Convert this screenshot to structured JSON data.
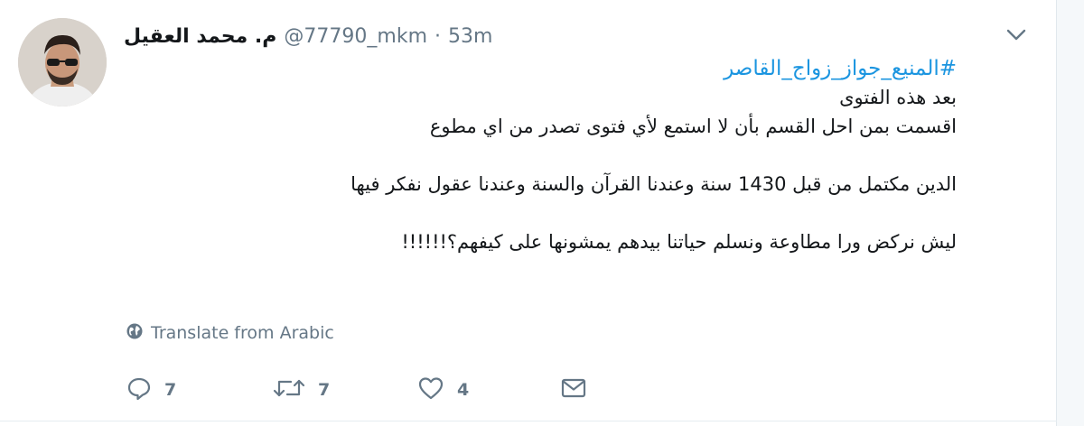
{
  "tweet": {
    "author_name": "م. محمد العقيل",
    "handle": "@77790_mkm",
    "separator": "·",
    "time": "53m",
    "hashtag": "#المنيع_جواز_زواج_القاصر",
    "lines": [
      "بعد هذه الفتوى",
      "اقسمت بمن احل القسم بأن لا استمع لأي فتوى تصدر من اي مطوع",
      "",
      "الدين مكتمل من قبل 1430 سنة وعندنا القرآن والسنة وعندنا عقول نفكر فيها",
      "",
      "ليش نركض ورا مطاوعة ونسلم حياتنا بيدهم يمشونها على كيفهم؟!!!!!!"
    ],
    "translate_label": "Translate from Arabic"
  },
  "actions": {
    "reply_count": "7",
    "retweet_count": "7",
    "like_count": "4"
  },
  "icons": {
    "caret": "chevron-down-icon",
    "globe": "globe-icon",
    "reply": "reply-icon",
    "retweet": "retweet-icon",
    "like": "heart-icon",
    "message": "envelope-icon"
  },
  "colors": {
    "link": "#1b95e0",
    "text": "#14171a",
    "muted": "#657786"
  }
}
